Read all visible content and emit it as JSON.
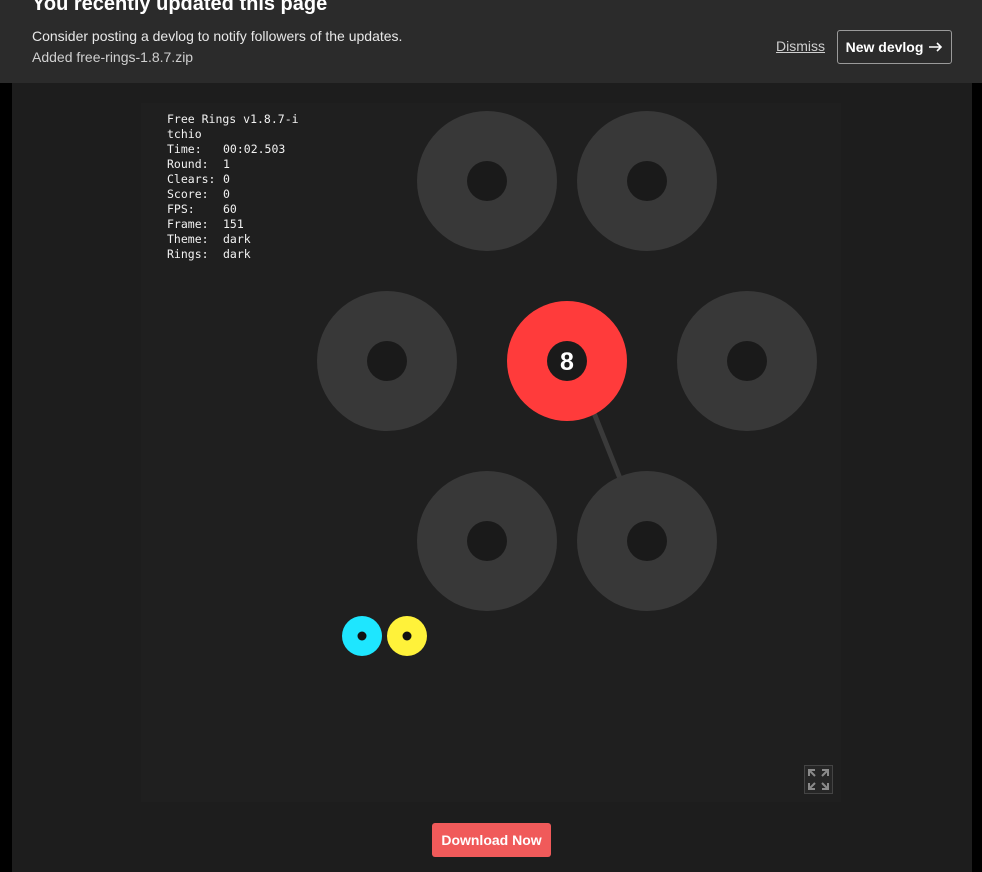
{
  "banner": {
    "title": "You recently updated this page",
    "message": "Consider posting a devlog to notify followers of the updates.",
    "sub": "Added free-rings-1.8.7.zip",
    "dismiss_label": "Dismiss",
    "new_devlog_label": "New devlog",
    "new_devlog_icon": "arrow-right-icon"
  },
  "game": {
    "title": "Free Rings v1.8.7-itchio",
    "stats": [
      {
        "key": "Time:",
        "value": "00:02.503"
      },
      {
        "key": "Round:",
        "value": "1"
      },
      {
        "key": "Clears:",
        "value": "0"
      },
      {
        "key": "Score:",
        "value": "0"
      },
      {
        "key": "FPS:",
        "value": "60"
      },
      {
        "key": "Frame:",
        "value": "151"
      },
      {
        "key": "Theme:",
        "value": "dark"
      },
      {
        "key": "Rings:",
        "value": "dark"
      }
    ],
    "active_ring_number": "8",
    "colors": {
      "background": "#1f1f1f",
      "ring": "#383838",
      "active_ring": "#ff3b3b",
      "hole": "#1a1a1a",
      "cyan": "#1ee6ff",
      "yellow": "#fff23a"
    },
    "fullscreen_icon": "expand-icon"
  },
  "download_label": "Download Now"
}
